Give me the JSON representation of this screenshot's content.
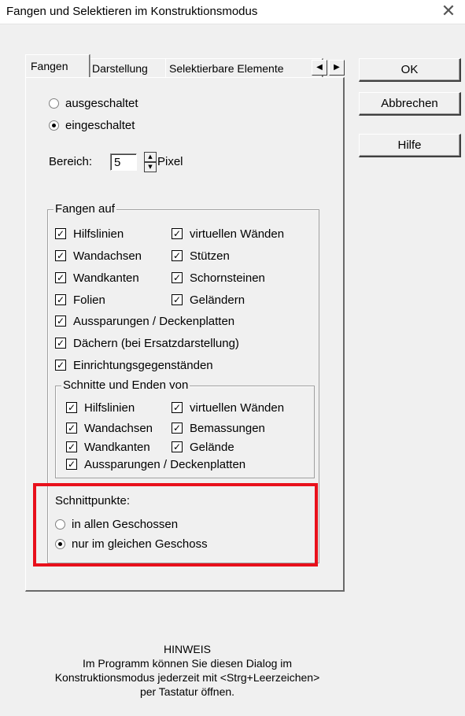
{
  "window": {
    "title": "Fangen und Selektieren im Konstruktionsmodus"
  },
  "tabs": [
    "Fangen",
    "Darstellung",
    "Selektierbare Elemente"
  ],
  "buttons": {
    "ok": "OK",
    "cancel": "Abbrechen",
    "help": "Hilfe"
  },
  "mode": {
    "off": "ausgeschaltet",
    "on": "eingeschaltet",
    "selected": "eingeschaltet"
  },
  "range": {
    "label": "Bereich:",
    "value": "5",
    "unit": "Pixel"
  },
  "snap_group": {
    "title": "Fangen auf",
    "left": [
      "Hilfslinien",
      "Wandachsen",
      "Wandkanten",
      "Folien"
    ],
    "right": [
      "virtuellen Wänden",
      "Stützen",
      "Schornsteinen",
      "Geländern"
    ],
    "full": [
      "Aussparungen / Deckenplatten",
      "Dächern (bei Ersatzdarstellung)",
      "Einrichtungsgegenständen"
    ]
  },
  "cuts_group": {
    "title": "Schnitte und Enden von",
    "left": [
      "Hilfslinien",
      "Wandachsen",
      "Wandkanten"
    ],
    "right": [
      "virtuellen Wänden",
      "Bemassungen",
      "Gelände"
    ],
    "full": [
      "Aussparungen / Deckenplatten"
    ]
  },
  "intersections": {
    "label": "Schnittpunkte:",
    "all": "in allen Geschossen",
    "same": "nur im gleichen Geschoss",
    "selected": "nur im gleichen Geschoss"
  },
  "hint": {
    "title": "HINWEIS",
    "lines": [
      "Im Programm können Sie diesen Dialog im",
      "Konstruktionsmodus jederzeit mit <Strg+Leerzeichen>",
      "per Tastatur öffnen."
    ]
  },
  "colors": {
    "highlight": "#e8101b",
    "dialog_bg": "#f0f0f0"
  }
}
